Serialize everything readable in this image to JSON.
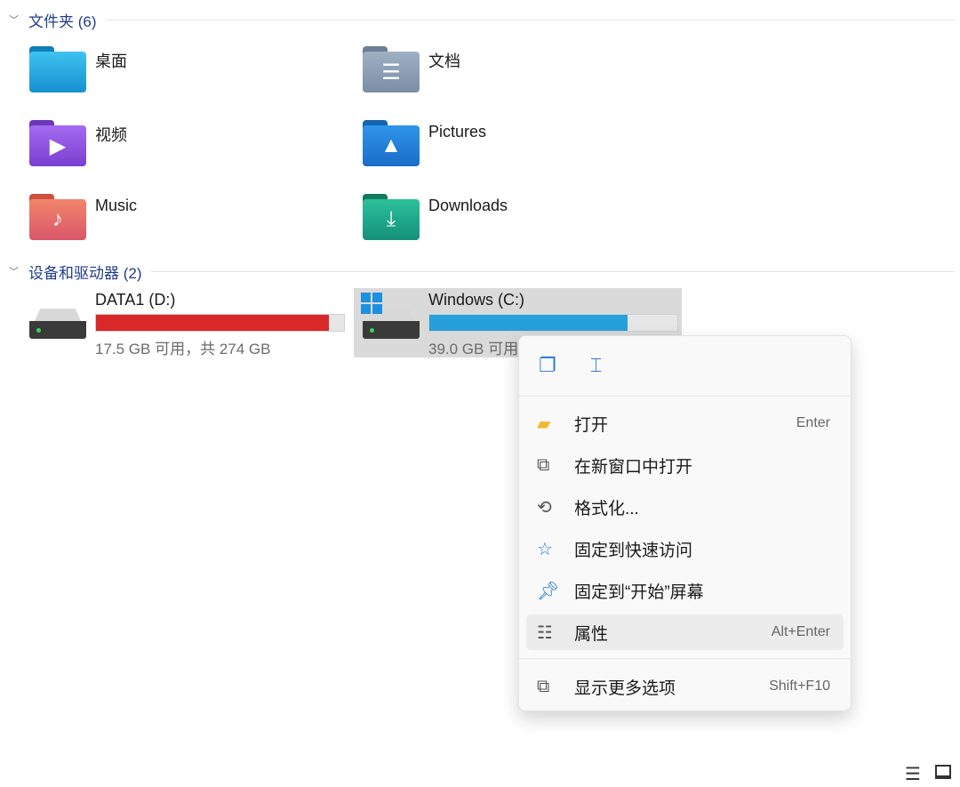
{
  "sections": {
    "folders": "文件夹 (6)",
    "drives": "设备和驱动器 (2)"
  },
  "folders": [
    {
      "name": "桌面",
      "icon": "desktop-folder-icon",
      "color": "#1aa3e0"
    },
    {
      "name": "文档",
      "icon": "documents-folder-icon",
      "color": "#8094ad"
    },
    {
      "name": "视频",
      "icon": "videos-folder-icon",
      "color": "#8a4fd8"
    },
    {
      "name": "Pictures",
      "icon": "pictures-folder-icon",
      "color": "#1f7fd6"
    },
    {
      "name": "Music",
      "icon": "music-folder-icon",
      "color": "#e66b5b"
    },
    {
      "name": "Downloads",
      "icon": "downloads-folder-icon",
      "color": "#1a9c7a"
    }
  ],
  "drives": [
    {
      "name": "DATA1 (D:)",
      "free": "17.5 GB 可用，共 274 GB",
      "used_percent": 94,
      "bar_color": "#d92828"
    },
    {
      "name": "Windows (C:)",
      "free": "39.0 GB 可用",
      "used_percent": 80,
      "bar_color": "#26a0da",
      "selected": true
    }
  ],
  "context_menu": {
    "top_actions": [
      {
        "icon": "copy-icon"
      },
      {
        "icon": "rename-icon"
      }
    ],
    "items": [
      {
        "label": "打开",
        "shortcut": "Enter",
        "icon": "open-folder-icon"
      },
      {
        "label": "在新窗口中打开",
        "shortcut": "",
        "icon": "open-new-window-icon"
      },
      {
        "label": "格式化...",
        "shortcut": "",
        "icon": "format-icon"
      },
      {
        "label": "固定到快速访问",
        "shortcut": "",
        "icon": "star-icon"
      },
      {
        "label": "固定到“开始”屏幕",
        "shortcut": "",
        "icon": "pin-icon"
      },
      {
        "label": "属性",
        "shortcut": "Alt+Enter",
        "icon": "properties-icon",
        "highlighted": true
      },
      {
        "label": "显示更多选项",
        "shortcut": "Shift+F10",
        "icon": "more-options-icon"
      }
    ]
  },
  "statusbar": {
    "icons": [
      "details-view-icon",
      "tiles-view-icon"
    ]
  }
}
